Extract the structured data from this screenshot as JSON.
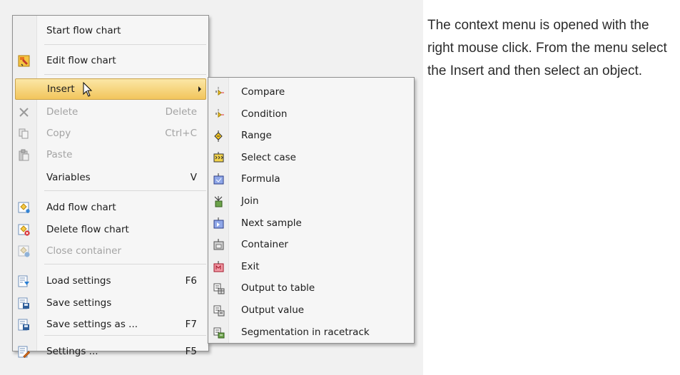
{
  "context_menu": {
    "start_flow_chart": "Start flow chart",
    "edit_flow_chart": "Edit flow chart",
    "insert": "Insert",
    "delete": "Delete",
    "delete_shortcut": "Delete",
    "copy": "Copy",
    "copy_shortcut": "Ctrl+C",
    "paste": "Paste",
    "variables": "Variables",
    "variables_shortcut": "V",
    "add_flow_chart": "Add flow chart",
    "delete_flow_chart": "Delete flow chart",
    "close_container": "Close container",
    "load_settings": "Load settings",
    "load_settings_shortcut": "F6",
    "save_settings": "Save settings",
    "save_settings_as": "Save settings as ...",
    "save_settings_as_shortcut": "F7",
    "settings": "Settings ...",
    "settings_shortcut": "F5"
  },
  "insert_submenu": [
    {
      "label": "Compare",
      "icon": "compare-icon"
    },
    {
      "label": "Condition",
      "icon": "condition-icon"
    },
    {
      "label": "Range",
      "icon": "range-icon"
    },
    {
      "label": "Select case",
      "icon": "select-case-icon"
    },
    {
      "label": "Formula",
      "icon": "formula-icon"
    },
    {
      "label": "Join",
      "icon": "join-icon"
    },
    {
      "label": "Next sample",
      "icon": "next-sample-icon"
    },
    {
      "label": "Container",
      "icon": "container-icon"
    },
    {
      "label": "Exit",
      "icon": "exit-icon"
    },
    {
      "label": "Output to table",
      "icon": "output-to-table-icon"
    },
    {
      "label": "Output value",
      "icon": "output-value-icon"
    },
    {
      "label": "Segmentation in racetrack",
      "icon": "segmentation-icon"
    }
  ],
  "description": "The context menu is opened with the right mouse click. From the menu select the Insert and then select an object."
}
